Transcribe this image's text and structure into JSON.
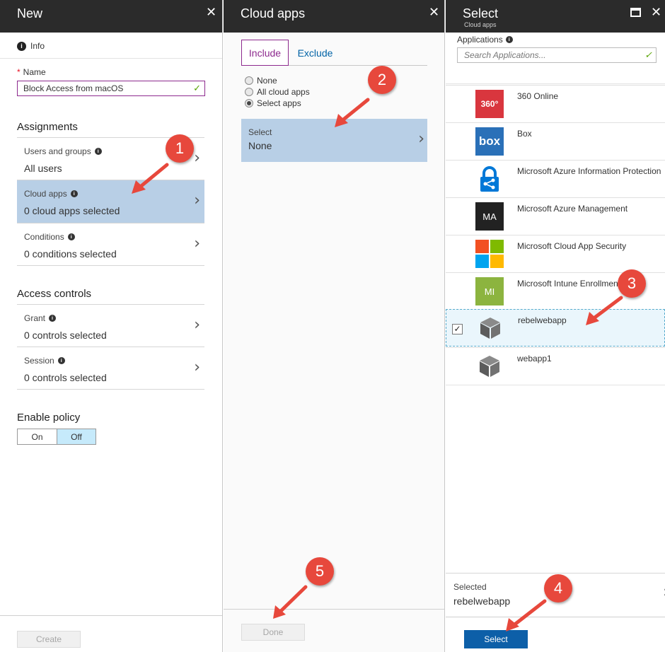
{
  "blade_new": {
    "title": "New",
    "info_label": "Info",
    "name_label": "Name",
    "name_value": "Block Access from macOS",
    "assignments_title": "Assignments",
    "users_label": "Users and groups",
    "users_value": "All users",
    "cloud_apps_label": "Cloud apps",
    "cloud_apps_value": "0 cloud apps selected",
    "conditions_label": "Conditions",
    "conditions_value": "0 conditions selected",
    "access_controls_title": "Access controls",
    "grant_label": "Grant",
    "grant_value": "0 controls selected",
    "session_label": "Session",
    "session_value": "0 controls selected",
    "enable_policy_title": "Enable policy",
    "toggle_on": "On",
    "toggle_off": "Off",
    "toggle_selected": "Off",
    "create_button": "Create"
  },
  "blade_cloud": {
    "title": "Cloud apps",
    "tab_include": "Include",
    "tab_exclude": "Exclude",
    "radio_none": "None",
    "radio_all": "All cloud apps",
    "radio_select": "Select apps",
    "radio_checked": "Select apps",
    "select_label": "Select",
    "select_value": "None",
    "done_button": "Done"
  },
  "blade_select": {
    "title": "Select",
    "subtitle": "Cloud apps",
    "applications_label": "Applications",
    "search_placeholder": "Search Applications...",
    "apps": [
      {
        "name": "360 Online",
        "logo_text": "360°",
        "logo_color": "#d9363e"
      },
      {
        "name": "Box",
        "logo_text": "box",
        "logo_color": "#2a70b8"
      },
      {
        "name": "Microsoft Azure Information Protection",
        "logo_text": "",
        "logo_color": "#0078d7"
      },
      {
        "name": "Microsoft Azure Management",
        "logo_text": "MA",
        "logo_color": "#222222"
      },
      {
        "name": "Microsoft Cloud App Security",
        "logo_text": "",
        "logo_color": "#f25022"
      },
      {
        "name": "Microsoft Intune Enrollment",
        "logo_text": "MI",
        "logo_color": "#8cb43f"
      },
      {
        "name": "rebelwebapp",
        "logo_text": "",
        "logo_color": "#666666",
        "selected": true
      },
      {
        "name": "webapp1",
        "logo_text": "",
        "logo_color": "#666666"
      }
    ],
    "selected_label": "Selected",
    "selected_value": "rebelwebapp",
    "select_button": "Select"
  },
  "callouts": [
    "1",
    "2",
    "3",
    "4",
    "5"
  ],
  "colors": {
    "header_bg": "#2b2b2b",
    "highlight_row": "#b8cfe6",
    "accent_purple": "#8d2a8e",
    "link_blue": "#0063a6",
    "primary_button": "#0d5fa8",
    "callout_red": "#e7483c"
  }
}
